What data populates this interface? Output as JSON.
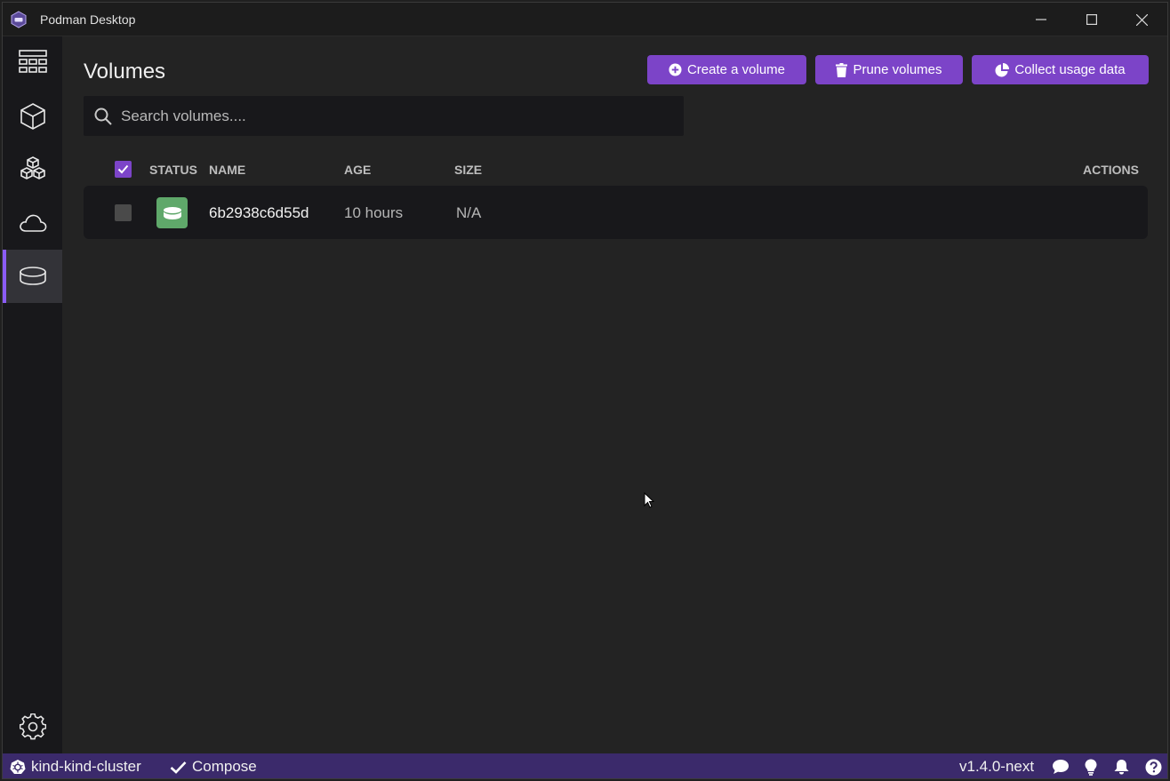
{
  "window": {
    "title": "Podman Desktop"
  },
  "sidebar": {
    "items": [
      {
        "name": "dashboard",
        "icon": "dashboard-icon"
      },
      {
        "name": "containers",
        "icon": "container-icon"
      },
      {
        "name": "pods",
        "icon": "pods-icon"
      },
      {
        "name": "images",
        "icon": "cloud-icon"
      },
      {
        "name": "volumes",
        "icon": "volume-icon",
        "active": true
      }
    ],
    "settings_icon": "gear-icon"
  },
  "page": {
    "title": "Volumes",
    "buttons": {
      "create": "Create a volume",
      "prune": "Prune volumes",
      "collect": "Collect usage data"
    },
    "search": {
      "placeholder": "Search volumes....",
      "value": ""
    }
  },
  "table": {
    "columns": {
      "status": "STATUS",
      "name": "NAME",
      "age": "AGE",
      "size": "SIZE",
      "actions": "ACTIONS"
    },
    "rows": [
      {
        "name": "6b2938c6d55d",
        "age": "10 hours",
        "size": "N/A",
        "status_color": "#5fa86a"
      }
    ]
  },
  "statusbar": {
    "cluster": "kind-kind-cluster",
    "compose": "Compose",
    "version": "v1.4.0-next"
  },
  "colors": {
    "accent": "#7c44c8",
    "statusbar": "#3b2a6b",
    "active_indicator": "#8b5cf6"
  }
}
